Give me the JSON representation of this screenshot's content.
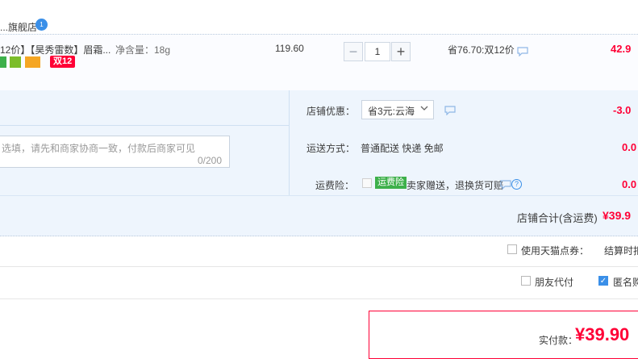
{
  "store": {
    "name": "...旗舰店",
    "badge": "1"
  },
  "item": {
    "title": "12价】【昊秀雷数】眉霜...",
    "spec": "净含量：18g",
    "price": "119.60",
    "quantity": "1",
    "qty_minus": "−",
    "qty_plus": "+",
    "save_text": "省76.70:双12价",
    "total": "42.9",
    "promo_tag": "双12",
    "icons": [
      "green-tag-icon",
      "android-tag-icon",
      "card-tag-icon",
      "chat-icon"
    ]
  },
  "memo": {
    "placeholder": "选填，请先和商家协商一致，付款后商家可见",
    "count": "0/200"
  },
  "coupon": {
    "label": "店铺优惠：",
    "value": "省3元:云海",
    "amount": "-3.0"
  },
  "shipping": {
    "label": "运送方式：",
    "value": "普通配送 快递 免邮",
    "amount": "0.0"
  },
  "insurance": {
    "label": "运费险：",
    "tag": "运费险",
    "desc": "卖家赠送，退换货可赔",
    "help": "?",
    "amount": "0.0"
  },
  "store_total": {
    "label": "店铺合计(含运费)",
    "amount": "¥39.9"
  },
  "options": {
    "tmall_points": "使用天猫点券：",
    "settle_note": "结算时扣",
    "friend_pay": "朋友代付",
    "anonymous": "匿名购",
    "anonymous_checked": "✓"
  },
  "payment": {
    "label": "实付款：",
    "amount": "¥39.90"
  },
  "colors": {
    "accent": "#ff0036",
    "blue": "#3a8fe8",
    "panel": "#eef5fd",
    "green": "#3db04a"
  }
}
